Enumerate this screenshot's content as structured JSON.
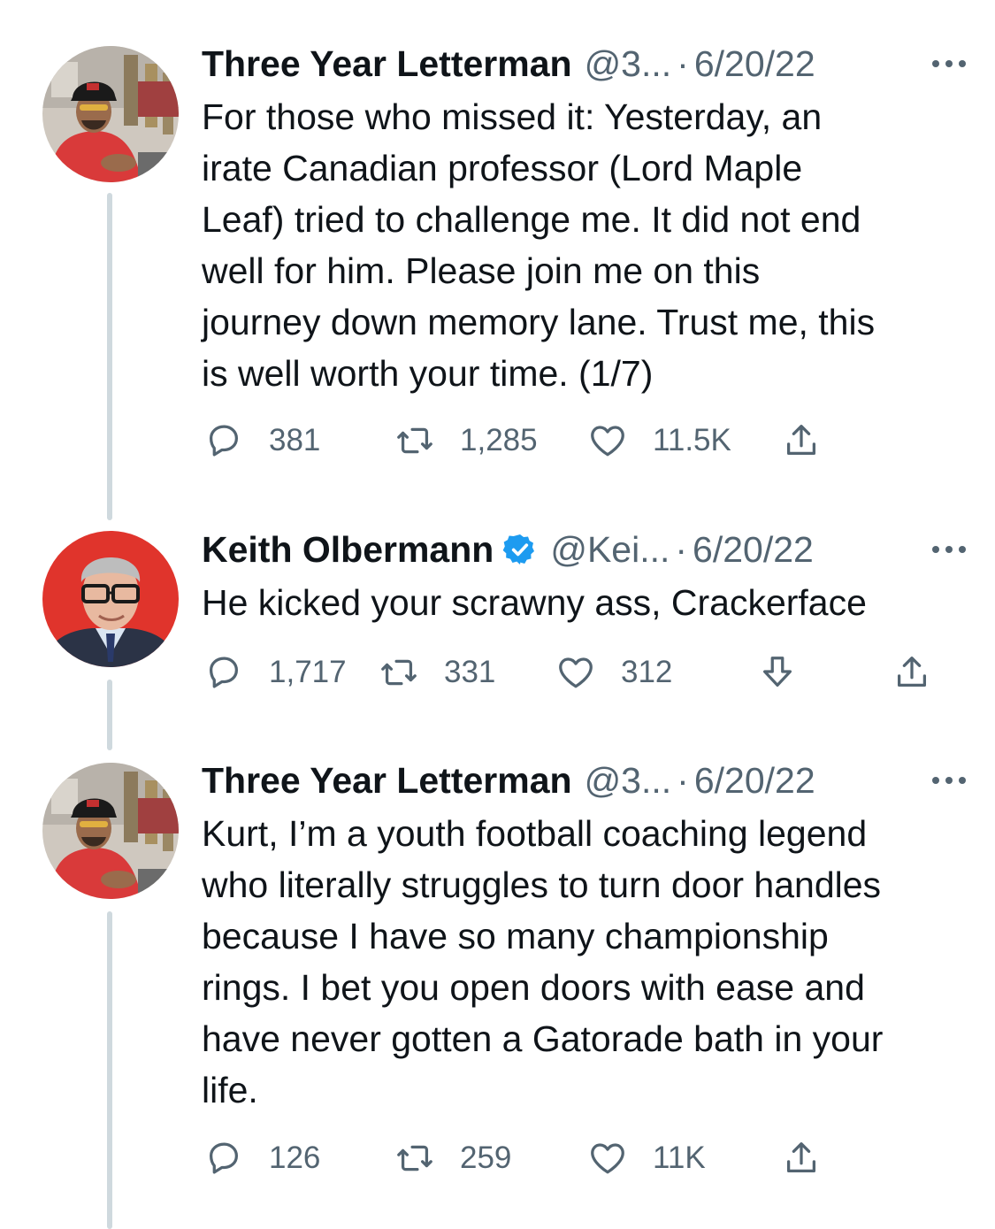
{
  "tweets": [
    {
      "name": "Three Year Letterman",
      "handle": "@3...",
      "separator": "·",
      "date": "6/20/22",
      "text": "For those who missed it: Yesterday, an\nirate Canadian professor (Lord Maple\nLeaf) tried to challenge me. It did not end\nwell for him. Please join me on this\njourney down memory lane. Trust me, this\nis well worth your time. (1/7)",
      "replies": "381",
      "retweets": "1,285",
      "likes": "11.5K",
      "verified": false
    },
    {
      "name": "Keith Olbermann",
      "handle": "@Kei...",
      "separator": "·",
      "date": "6/20/22",
      "text": "He kicked your scrawny ass, Crackerface",
      "replies": "1,717",
      "retweets": "331",
      "likes": "312",
      "verified": true
    },
    {
      "name": "Three Year Letterman",
      "handle": "@3...",
      "separator": "·",
      "date": "6/20/22",
      "text": "Kurt, I’m a youth football coaching legend\nwho literally struggles to turn door handles\nbecause I have so many championship\nrings. I bet you open doors with ease and\nhave never gotten a Gatorade bath in your\nlife.",
      "replies": "126",
      "retweets": "259",
      "likes": "11K",
      "verified": false
    }
  ],
  "icons": {
    "reply": "reply-icon",
    "retweet": "retweet-icon",
    "like": "heart-icon",
    "share": "share-icon",
    "downvote": "downvote-icon",
    "more": "more-icon",
    "verified": "verified-badge-icon"
  },
  "colors": {
    "text": "#0f1419",
    "secondary": "#536471",
    "thread_line": "#cfd9de",
    "verified": "#1d9bf0"
  }
}
